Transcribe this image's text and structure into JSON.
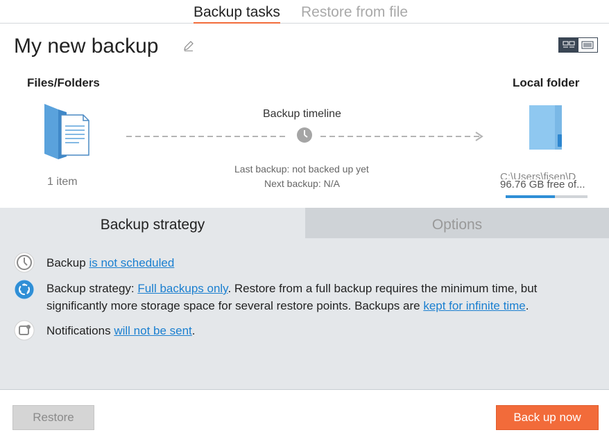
{
  "tabs": {
    "active": "Backup tasks",
    "inactive": "Restore from file"
  },
  "backup": {
    "title": "My new backup"
  },
  "source": {
    "heading": "Files/Folders",
    "count": "1 item"
  },
  "timeline": {
    "label": "Backup timeline",
    "last_backup": "Last backup: not backed up yet",
    "next_backup": "Next backup: N/A"
  },
  "destination": {
    "heading": "Local folder",
    "path": "C:\\Users\\fisen\\D",
    "free": "96.76 GB free of...",
    "used_fraction": 0.6
  },
  "panel": {
    "tab_strategy": "Backup strategy",
    "tab_options": "Options",
    "schedule": {
      "prefix": "Backup ",
      "link": "is not scheduled"
    },
    "strategy": {
      "prefix": "Backup strategy: ",
      "link1": "Full backups only",
      "middle": ". Restore from a full backup requires the minimum time, but significantly more storage space for several restore points. Backups are ",
      "link2": "kept for infinite time",
      "suffix": "."
    },
    "notifications": {
      "prefix": "Notifications ",
      "link": "will not be sent",
      "suffix": "."
    }
  },
  "buttons": {
    "restore": "Restore",
    "backup_now": "Back up now"
  },
  "colors": {
    "accent": "#f26b3a",
    "link": "#1a7fd0",
    "panel_bg": "#e4e7ea"
  }
}
